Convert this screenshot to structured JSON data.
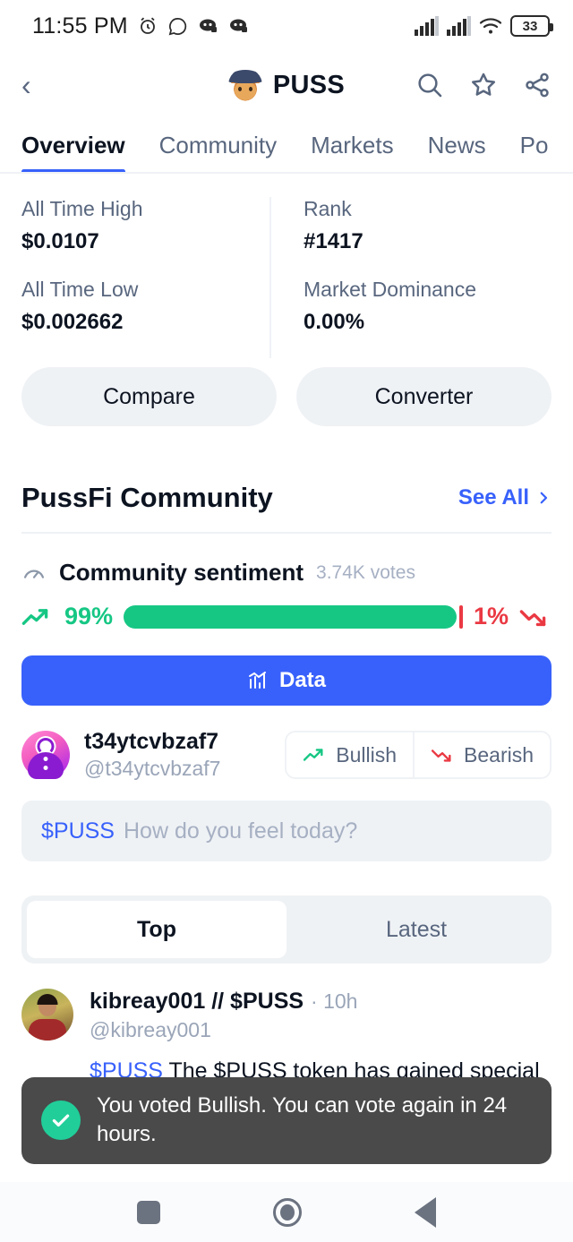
{
  "status_bar": {
    "time": "11:55 PM",
    "battery_percent": "33",
    "icons": [
      "alarm-icon",
      "whatsapp-icon",
      "discord-icon",
      "discord-icon"
    ],
    "right_icons": [
      "signal-icon",
      "signal-icon",
      "wifi-icon",
      "battery-icon"
    ]
  },
  "header": {
    "back_icon": "chevron-left-icon",
    "coin_symbol": "PUSS",
    "logo_icon": "puss-cat-logo-icon",
    "actions": [
      {
        "name": "search-icon"
      },
      {
        "name": "star-icon"
      },
      {
        "name": "share-icon"
      }
    ]
  },
  "tabs": [
    {
      "label": "Overview",
      "active": true
    },
    {
      "label": "Community",
      "active": false
    },
    {
      "label": "Markets",
      "active": false
    },
    {
      "label": "News",
      "active": false
    },
    {
      "label": "Po",
      "active": false
    }
  ],
  "stats": {
    "left": [
      {
        "label": "All Time High",
        "value": "$0.0107"
      },
      {
        "label": "All Time Low",
        "value": "$0.002662"
      }
    ],
    "right": [
      {
        "label": "Rank",
        "value": "#1417"
      },
      {
        "label": "Market Dominance",
        "value": "0.00%"
      }
    ]
  },
  "actions": {
    "compare_label": "Compare",
    "converter_label": "Converter"
  },
  "community": {
    "title": "PussFi Community",
    "see_all_label": "See All",
    "see_all_icon": "chevron-right-icon",
    "sentiment": {
      "gauge_icon": "gauge-icon",
      "title": "Community sentiment",
      "votes": "3.74K votes",
      "bullish_percent": "99%",
      "bearish_percent": "1%",
      "bullish_value": 99,
      "bearish_value": 1,
      "bullish_color": "#16c784",
      "bearish_color": "#ea3943",
      "trend_up_icon": "trend-up-icon",
      "trend_down_icon": "trend-down-icon"
    },
    "data_button": {
      "label": "Data",
      "icon": "bar-chart-icon",
      "color": "#3861fb"
    }
  },
  "composer": {
    "avatar_icon": "cmc-avatar-icon",
    "name": "t34ytcvbzaf7",
    "handle": "@t34ytcvbzaf7",
    "bullish_label": "Bullish",
    "bearish_label": "Bearish",
    "bullish_icon": "trend-up-icon",
    "bearish_icon": "trend-down-icon",
    "ticker": "$PUSS",
    "placeholder": "How do you feel today?"
  },
  "feed_tabs": [
    {
      "label": "Top",
      "active": true
    },
    {
      "label": "Latest",
      "active": false
    }
  ],
  "post": {
    "avatar_icon": "user-photo-avatar",
    "name": "kibreay001 // $PUSS",
    "time": "· 10h",
    "handle": "@kibreay001",
    "ticker": "$PUSS",
    "body": "The $PUSS token has gained special recognition. It is a digital currency designed for specific purposes and functions"
  },
  "toast": {
    "icon": "check-circle-icon",
    "message": "You voted Bullish. You can vote again in 24 hours.",
    "background": "#4a4a4a",
    "icon_color": "#21ce99"
  },
  "navbar": {
    "recents_icon": "square-icon",
    "home_icon": "circle-icon",
    "back_icon": "triangle-back-icon"
  }
}
